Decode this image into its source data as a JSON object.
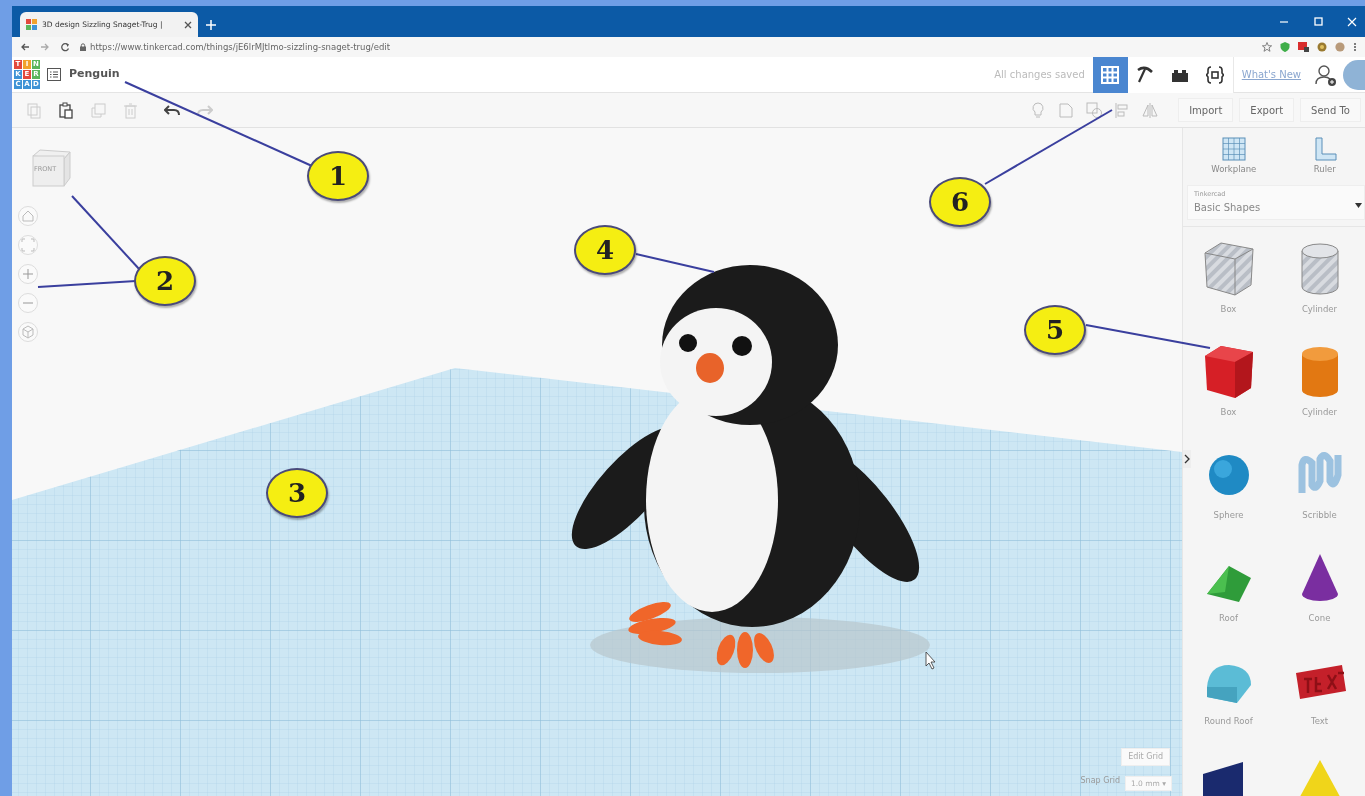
{
  "browser": {
    "tab_title": "3D design Sizzling Snaget-Trug |",
    "url": "https://www.tinkercad.com/things/jE6lrMJtlmo-sizzling-snaget-trug/edit"
  },
  "app": {
    "logo_rows": [
      [
        "T",
        "I",
        "N"
      ],
      [
        "K",
        "E",
        "R"
      ],
      [
        "C",
        "A",
        "D"
      ]
    ],
    "project_name": "Penguin",
    "save_status": "All changes saved",
    "views": [
      {
        "kind": "grid",
        "selected": true
      },
      {
        "kind": "pickaxe",
        "selected": false
      },
      {
        "kind": "bricks",
        "selected": false
      },
      {
        "kind": "code",
        "selected": false
      }
    ],
    "whats_new": "What's New"
  },
  "toolbar": {
    "edit_tools": [
      {
        "kind": "copy",
        "disabled": true
      },
      {
        "kind": "paste",
        "disabled": false
      },
      {
        "kind": "duplicate",
        "disabled": true
      },
      {
        "kind": "delete",
        "disabled": true
      },
      {
        "kind": "undo",
        "disabled": false
      },
      {
        "kind": "redo",
        "disabled": true
      }
    ],
    "shape_tools": [
      {
        "kind": "bulb"
      },
      {
        "kind": "group"
      },
      {
        "kind": "ungroup"
      },
      {
        "kind": "align"
      },
      {
        "kind": "mirror"
      }
    ],
    "actions": [
      "Import",
      "Export",
      "Send To"
    ]
  },
  "view_cube": {
    "front": "FRONT"
  },
  "panel": {
    "tools": [
      "Workplane",
      "Ruler"
    ],
    "library": {
      "source": "Tinkercad",
      "name": "Basic Shapes"
    },
    "shapes": [
      {
        "kind": "box-hole",
        "name": "Box"
      },
      {
        "kind": "cylinder-hole",
        "name": "Cylinder"
      },
      {
        "kind": "box",
        "name": "Box"
      },
      {
        "kind": "cylinder",
        "name": "Cylinder"
      },
      {
        "kind": "sphere",
        "name": "Sphere"
      },
      {
        "kind": "scribble",
        "name": "Scribble"
      },
      {
        "kind": "roof",
        "name": "Roof"
      },
      {
        "kind": "cone",
        "name": "Cone"
      },
      {
        "kind": "round-roof",
        "name": "Round Roof"
      },
      {
        "kind": "text",
        "name": "Text"
      },
      {
        "kind": "tube"
      },
      {
        "kind": "pyramid"
      }
    ]
  },
  "grid": {
    "edit": "Edit Grid",
    "snap_label": "Snap Grid",
    "snap_value": "1.0 mm ▾"
  },
  "annotations": [
    "1",
    "2",
    "3",
    "4",
    "5",
    "6"
  ]
}
